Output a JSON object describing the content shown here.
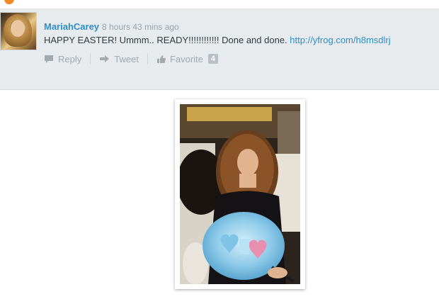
{
  "tweet": {
    "username": "MariahCarey",
    "timestamp": "8 hours 43 mins ago",
    "text_prefix": "HAPPY EASTER! Ummm.. READY!!!!!!!!!!!! Done and done. ",
    "link": "http://yfrog.com/h8msdlrj",
    "actions": {
      "reply_label": "Reply",
      "tweet_label": "Tweet",
      "favorite_label": "Favorite",
      "favorite_count": "4"
    }
  },
  "colors": {
    "accent_link": "#2d8ec9",
    "card_background": "#e8ebed",
    "action_gray": "#a2aaaf"
  },
  "icons": {
    "reply": "speech-bubble-icon",
    "retweet": "arrow-right-icon",
    "favorite": "thumbs-up-icon"
  }
}
